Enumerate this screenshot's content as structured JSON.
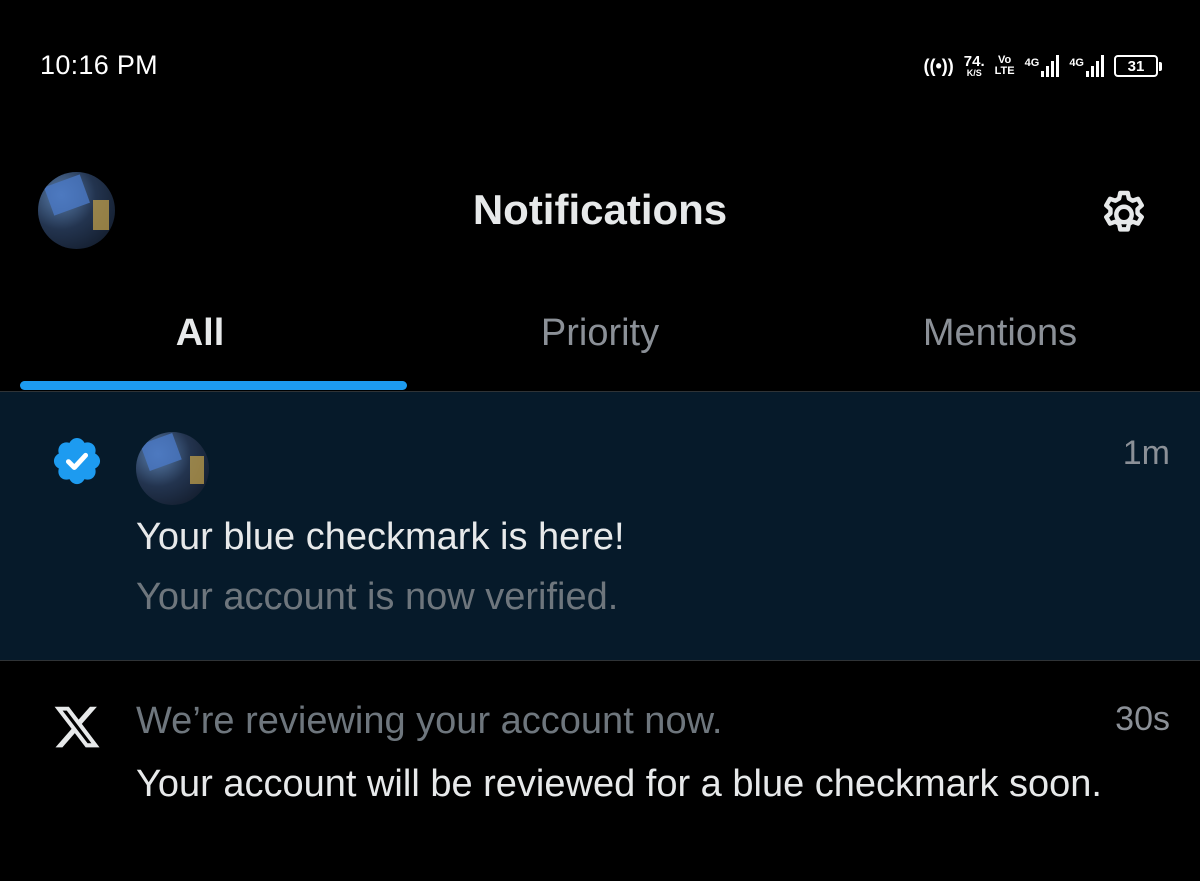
{
  "status_bar": {
    "time": "10:16 PM",
    "hotspot": "((•))",
    "speed_value": "74.",
    "speed_unit": "K/S",
    "volte_top": "Vo",
    "volte_bottom": "LTE",
    "network1": "4G",
    "network2": "4G",
    "battery": "31"
  },
  "header": {
    "title": "Notifications",
    "settings_icon": "gear-icon",
    "avatar_icon": "profile-avatar"
  },
  "tabs": [
    {
      "label": "All",
      "active": true
    },
    {
      "label": "Priority",
      "active": false
    },
    {
      "label": "Mentions",
      "active": false
    }
  ],
  "notifications": [
    {
      "icon": "verified-badge-icon",
      "time": "1m",
      "title": "Your blue checkmark is here!",
      "subtitle": "Your account is now verified.",
      "highlighted": true
    },
    {
      "icon": "x-logo-icon",
      "time": "30s",
      "title": "We’re reviewing your account now.",
      "body": "Your account will be reviewed for a blue checkmark soon.",
      "highlighted": false
    }
  ],
  "colors": {
    "accent": "#1d9bf0",
    "background": "#000000",
    "highlight_row": "#061a2a",
    "text_primary": "#e7e9ea",
    "text_secondary": "#6e767d"
  }
}
